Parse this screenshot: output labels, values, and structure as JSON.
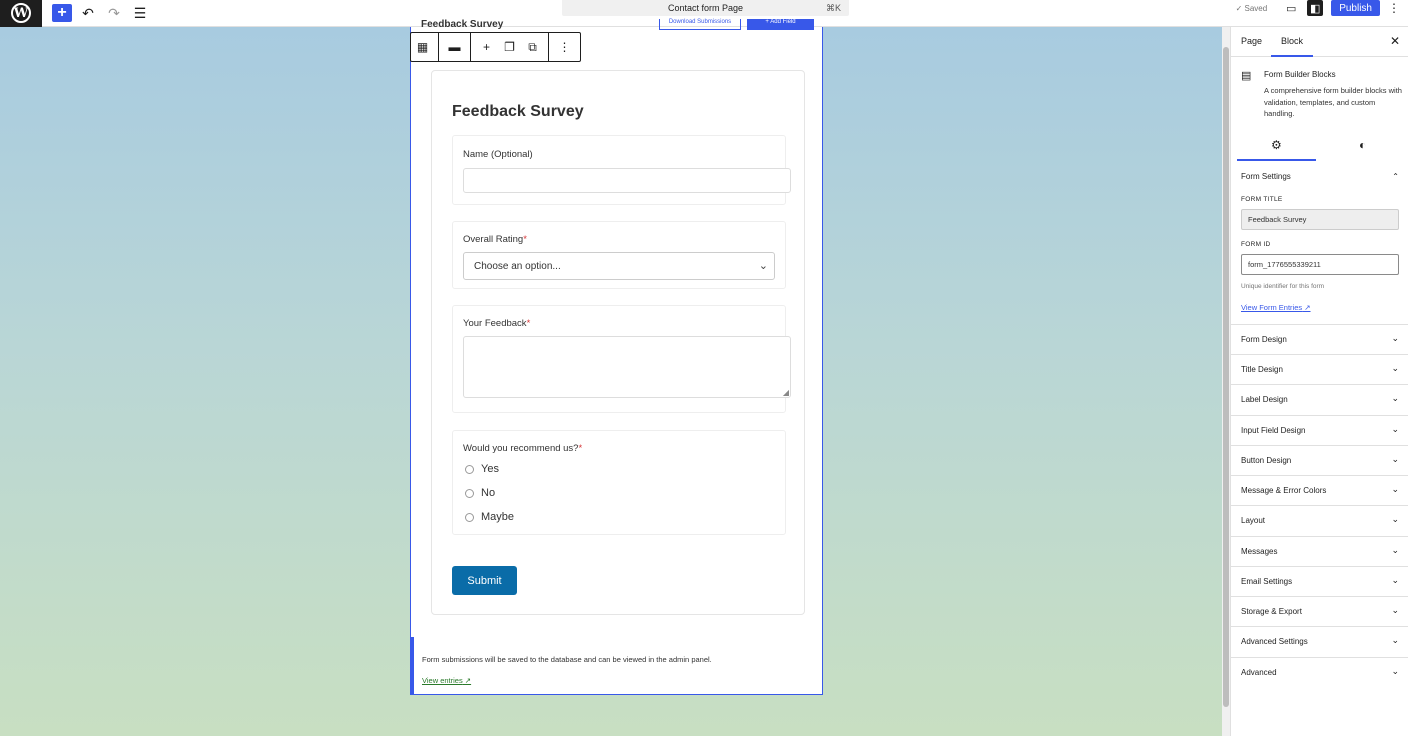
{
  "topbar": {
    "doc_title": "Contact form Page",
    "shortcut": "⌘K",
    "saved": "✓ Saved",
    "publish": "Publish"
  },
  "block_top": {
    "cut_title": "Feedback Survey",
    "btn_outline": "Download Submissions",
    "btn_solid": "+ Add Field"
  },
  "form": {
    "title": "Feedback Survey",
    "fields": [
      {
        "label": "Name (Optional)",
        "required": false,
        "type": "text"
      },
      {
        "label": "Overall Rating",
        "required": true,
        "type": "select",
        "placeholder": "Choose an option..."
      },
      {
        "label": "Your Feedback",
        "required": true,
        "type": "textarea"
      },
      {
        "label": "Would you recommend us?",
        "required": true,
        "type": "radio",
        "options": [
          "Yes",
          "No",
          "Maybe"
        ]
      }
    ],
    "submit": "Submit"
  },
  "note": {
    "text": "Form submissions will be saved to the database and can be viewed in the admin panel.",
    "link": "View entries"
  },
  "sidebar": {
    "tabs": [
      "Page",
      "Block"
    ],
    "block_name": "Form Builder Blocks",
    "block_desc": "A comprehensive form builder blocks with validation, templates, and custom handling.",
    "form_settings": "Form Settings",
    "form_title_label": "FORM TITLE",
    "form_title_value": "Feedback Survey",
    "form_id_label": "FORM ID",
    "form_id_value": "form_1776555339211",
    "form_id_help": "Unique identifier for this form",
    "view_entries": "View Form Entries",
    "panels": [
      "Form Design",
      "Title Design",
      "Label Design",
      "Input Field Design",
      "Button Design",
      "Message & Error Colors",
      "Layout",
      "Messages",
      "Email Settings",
      "Storage & Export",
      "Advanced Settings",
      "Advanced"
    ]
  }
}
